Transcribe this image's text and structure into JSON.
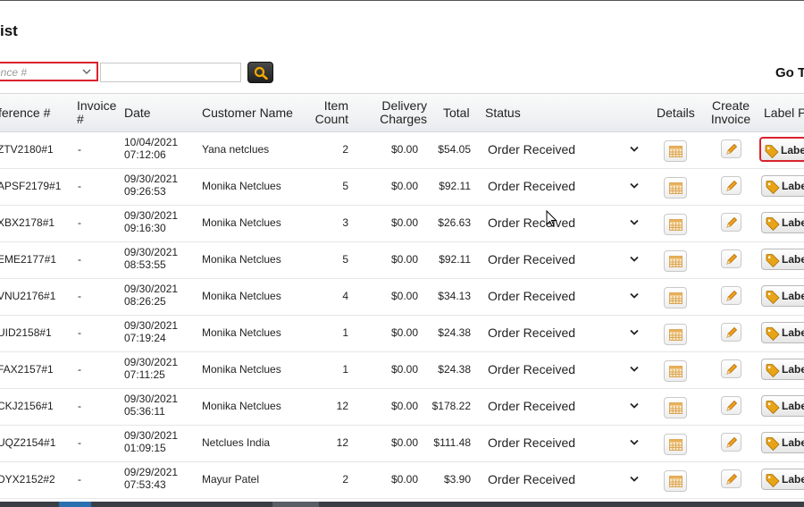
{
  "page": {
    "title": "ist"
  },
  "search": {
    "select_value": "ence #",
    "input_value": "",
    "goto_label": "Go T"
  },
  "table": {
    "headers": {
      "reference": "ference #",
      "invoice": [
        "Invoice",
        "#"
      ],
      "date": "Date",
      "customer": "Customer Name",
      "item_count": [
        "Item",
        "Count"
      ],
      "delivery": [
        "Delivery",
        "Charges"
      ],
      "total": "Total",
      "status": "Status",
      "details": "Details",
      "create_invoice": [
        "Create",
        "Invoice"
      ],
      "label": "Label P"
    },
    "rows": [
      {
        "ref": "ZTV2180#1",
        "invoice": "-",
        "date": "10/04/2021",
        "time": "07:12:06",
        "customer": "Yana netclues",
        "count": "2",
        "delivery": "$0.00",
        "total": "$54.05",
        "status": "Order Received",
        "label": "Labe"
      },
      {
        "ref": "APSF2179#1",
        "invoice": "-",
        "date": "09/30/2021",
        "time": "09:26:53",
        "customer": "Monika Netclues",
        "count": "5",
        "delivery": "$0.00",
        "total": "$92.11",
        "status": "Order Received",
        "label": "Labe"
      },
      {
        "ref": "XBX2178#1",
        "invoice": "-",
        "date": "09/30/2021",
        "time": "09:16:30",
        "customer": "Monika Netclues",
        "count": "3",
        "delivery": "$0.00",
        "total": "$26.63",
        "status": "Order Received",
        "label": "Labe"
      },
      {
        "ref": "EME2177#1",
        "invoice": "-",
        "date": "09/30/2021",
        "time": "08:53:55",
        "customer": "Monika Netclues",
        "count": "5",
        "delivery": "$0.00",
        "total": "$92.11",
        "status": "Order Received",
        "label": "Labe"
      },
      {
        "ref": "VNU2176#1",
        "invoice": "-",
        "date": "09/30/2021",
        "time": "08:26:25",
        "customer": "Monika Netclues",
        "count": "4",
        "delivery": "$0.00",
        "total": "$34.13",
        "status": "Order Received",
        "label": "Labe"
      },
      {
        "ref": "UID2158#1",
        "invoice": "-",
        "date": "09/30/2021",
        "time": "07:19:24",
        "customer": "Monika Netclues",
        "count": "1",
        "delivery": "$0.00",
        "total": "$24.38",
        "status": "Order Received",
        "label": "Labe"
      },
      {
        "ref": "FAX2157#1",
        "invoice": "-",
        "date": "09/30/2021",
        "time": "07:11:25",
        "customer": "Monika Netclues",
        "count": "1",
        "delivery": "$0.00",
        "total": "$24.38",
        "status": "Order Received",
        "label": "Labe"
      },
      {
        "ref": "CKJ2156#1",
        "invoice": "-",
        "date": "09/30/2021",
        "time": "05:36:11",
        "customer": "Monika Netclues",
        "count": "12",
        "delivery": "$0.00",
        "total": "$178.22",
        "status": "Order Received",
        "label": "Labe"
      },
      {
        "ref": "UQZ2154#1",
        "invoice": "-",
        "date": "09/30/2021",
        "time": "01:09:15",
        "customer": "Netclues India",
        "count": "12",
        "delivery": "$0.00",
        "total": "$111.48",
        "status": "Order Received",
        "label": "Labe"
      },
      {
        "ref": "DYX2152#2",
        "invoice": "-",
        "date": "09/29/2021",
        "time": "07:53:43",
        "customer": "Mayur Patel",
        "count": "2",
        "delivery": "$0.00",
        "total": "$3.90",
        "status": "Order Received",
        "label": "Labe"
      }
    ]
  },
  "colors": {
    "highlight": "#d9232d",
    "search_button": "#2a2a2a",
    "search_icon": "#f0a800",
    "tag_icon": "#e8a317"
  }
}
